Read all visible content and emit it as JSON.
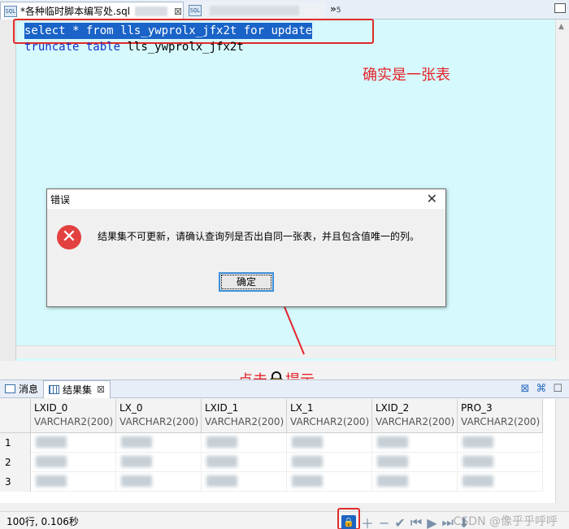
{
  "editor_tabs": [
    {
      "label": "*各种临时脚本编写处.sql",
      "icon": "sql-file-icon"
    },
    {
      "label": "",
      "icon": "sql-file-icon"
    }
  ],
  "tab_overflow": {
    "glyph": "»",
    "count": "5"
  },
  "editor": {
    "lines": [
      "select * from lls_ywprolx_jfx2t for update",
      "truncate table lls_ywprolx_jfx2t"
    ],
    "line1_kw": [
      "select",
      " * ",
      "from",
      " lls_ywprolx_jfx2t ",
      "for",
      " ",
      "update"
    ],
    "line2_kw": [
      "truncate",
      " ",
      "table",
      " lls_ywprolx_jfx2t"
    ]
  },
  "annotations": {
    "is_table": "确实是一张表",
    "lock_hint_prefix": "点击",
    "lock_hint_suffix": "提示"
  },
  "dialog": {
    "title": "错误",
    "message": "结果集不可更新，请确认查询列是否出自同一张表，并且包含值唯一的列。",
    "ok": "确定"
  },
  "panel_tabs": [
    {
      "label": "消息"
    },
    {
      "label": "结果集"
    }
  ],
  "table": {
    "columns": [
      {
        "name": "LXID_0",
        "type": "VARCHAR2(200)"
      },
      {
        "name": "LX_0",
        "type": "VARCHAR2(200)"
      },
      {
        "name": "LXID_1",
        "type": "VARCHAR2(200)"
      },
      {
        "name": "LX_1",
        "type": "VARCHAR2(200)"
      },
      {
        "name": "LXID_2",
        "type": "VARCHAR2(200)"
      },
      {
        "name": "PRO_3",
        "type": "VARCHAR2(200)"
      }
    ],
    "row_numbers": [
      "1",
      "2",
      "3"
    ]
  },
  "status": {
    "text": "100行, 0.106秒"
  },
  "watermark": "CSDN @像乎乎呼呼",
  "colors": {
    "annotation": "#e5232a",
    "selection": "#1a63c8",
    "editor_bg": "#d5f9fc",
    "error_icon": "#e34040"
  }
}
